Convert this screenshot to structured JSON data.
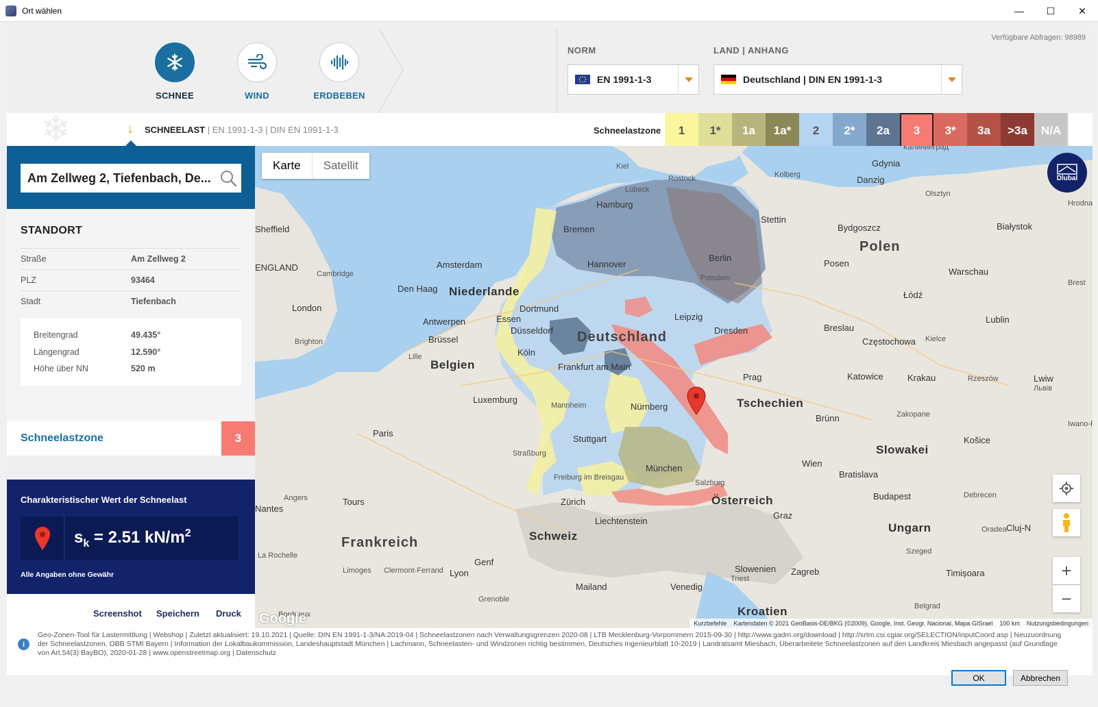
{
  "window": {
    "title": "Ort wählen",
    "minimize": "—",
    "maximize": "☐",
    "close": "✕"
  },
  "header": {
    "tabs": [
      {
        "label": "SCHNEE",
        "icon": "snowflake-icon",
        "active": true
      },
      {
        "label": "WIND",
        "icon": "wind-icon",
        "active": false
      },
      {
        "label": "ERDBEBEN",
        "icon": "earthquake-icon",
        "active": false
      }
    ],
    "available_queries": "Verfügbare Abfragen: 98989",
    "norm_label": "NORM",
    "norm_value": "EN 1991-1-3",
    "country_label": "LAND | ANHANG",
    "country_value": "Deutschland | DIN EN 1991-1-3"
  },
  "subbar": {
    "title": "SCHNEELAST",
    "sep1": " | ",
    "norm1": "EN 1991-1-3",
    "sep2": " | ",
    "norm2": "DIN EN 1991-1-3",
    "zones_label": "Schneelastzone",
    "zones": [
      {
        "label": "1",
        "color": "#fbf59e",
        "text": "#555"
      },
      {
        "label": "1*",
        "color": "#e0df9a",
        "text": "#555"
      },
      {
        "label": "1a",
        "color": "#b7b47c",
        "text": "#fff"
      },
      {
        "label": "1a*",
        "color": "#8b8858",
        "text": "#fff"
      },
      {
        "label": "2",
        "color": "#b5d4f2",
        "text": "#555"
      },
      {
        "label": "2*",
        "color": "#85a9cc",
        "text": "#fff"
      },
      {
        "label": "2a",
        "color": "#5d7590",
        "text": "#fff"
      },
      {
        "label": "3",
        "color": "#f77b72",
        "text": "#fff",
        "selected": true
      },
      {
        "label": "3*",
        "color": "#d96a5f",
        "text": "#fff"
      },
      {
        "label": "3a",
        "color": "#b55247",
        "text": "#fff"
      },
      {
        "label": ">3a",
        "color": "#8c3a33",
        "text": "#fff"
      },
      {
        "label": "N/A",
        "color": "#c6c6c6",
        "text": "#fff"
      }
    ]
  },
  "search": {
    "value": "Am Zellweg 2, Tiefenbach, De..."
  },
  "standort": {
    "title": "STANDORT",
    "rows": [
      {
        "key": "Straße",
        "value": "Am Zellweg 2"
      },
      {
        "key": "PLZ",
        "value": "93464"
      },
      {
        "key": "Stadt",
        "value": "Tiefenbach"
      }
    ],
    "geo": [
      {
        "key": "Breitengrad",
        "value": "49.435°"
      },
      {
        "key": "Längengrad",
        "value": "12.590°"
      },
      {
        "key": "Höhe über NN",
        "value": "520 m"
      }
    ]
  },
  "zone_result": {
    "label": "Schneelastzone",
    "value": "3"
  },
  "result": {
    "title": "Charakteristischer Wert der Schneelast",
    "symbol": "s",
    "subscript": "k",
    "value": " = 2.51 kN/m",
    "superscript": "2",
    "note": "Alle Angaben ohne Gewähr"
  },
  "actions": [
    "Screenshot",
    "Speichern",
    "Druck"
  ],
  "map": {
    "toggle": [
      "Karte",
      "Satellit"
    ],
    "brand": "Dlubal",
    "zoom_in": "+",
    "zoom_out": "−",
    "google": "Google",
    "footer": [
      "Kurzbefehle",
      "Kartendaten © 2021 GeoBasis-DE/BKG (©2009), Google, Inst. Geogr. Nacional, Mapa GISrael",
      "100 km",
      "Nutzungsbedingungen"
    ],
    "labels": [
      {
        "t": "Deutschland",
        "cls": "big"
      },
      {
        "t": "Polen",
        "cls": "big"
      },
      {
        "t": "Tschechien",
        "cls": "country"
      },
      {
        "t": "Österreich",
        "cls": "country"
      },
      {
        "t": "Frankreich",
        "cls": "big"
      },
      {
        "t": "Schweiz",
        "cls": "country"
      },
      {
        "t": "Slowakei",
        "cls": "country"
      },
      {
        "t": "Ungarn",
        "cls": "country"
      },
      {
        "t": "Kroatien",
        "cls": "country"
      },
      {
        "t": "Belgien",
        "cls": "country"
      },
      {
        "t": "Niederlande",
        "cls": "country"
      },
      {
        "t": "Slowenien",
        "cls": ""
      },
      {
        "t": "Liechtenstein",
        "cls": ""
      },
      {
        "t": "Luxemburg",
        "cls": ""
      },
      {
        "t": "Hamburg",
        "cls": ""
      },
      {
        "t": "Bremen",
        "cls": ""
      },
      {
        "t": "Hannover",
        "cls": ""
      },
      {
        "t": "Berlin",
        "cls": ""
      },
      {
        "t": "Potsdam",
        "cls": "small"
      },
      {
        "t": "Leipzig",
        "cls": ""
      },
      {
        "t": "Dresden",
        "cls": ""
      },
      {
        "t": "Dortmund",
        "cls": ""
      },
      {
        "t": "Essen",
        "cls": ""
      },
      {
        "t": "Düsseldorf",
        "cls": ""
      },
      {
        "t": "Köln",
        "cls": ""
      },
      {
        "t": "Frankfurt am Main",
        "cls": ""
      },
      {
        "t": "Mannheim",
        "cls": "small"
      },
      {
        "t": "Nürnberg",
        "cls": ""
      },
      {
        "t": "Stuttgart",
        "cls": ""
      },
      {
        "t": "München",
        "cls": ""
      },
      {
        "t": "Freiburg im Breisgau",
        "cls": "small"
      },
      {
        "t": "Amsterdam",
        "cls": ""
      },
      {
        "t": "Den Haag",
        "cls": ""
      },
      {
        "t": "Antwerpen",
        "cls": ""
      },
      {
        "t": "Brüssel",
        "cls": ""
      },
      {
        "t": "London",
        "cls": ""
      },
      {
        "t": "Paris",
        "cls": ""
      },
      {
        "t": "Prag",
        "cls": ""
      },
      {
        "t": "Wien",
        "cls": ""
      },
      {
        "t": "Bratislava",
        "cls": ""
      },
      {
        "t": "Budapest",
        "cls": ""
      },
      {
        "t": "Zürich",
        "cls": ""
      },
      {
        "t": "Salzburg",
        "cls": "small"
      },
      {
        "t": "Graz",
        "cls": ""
      },
      {
        "t": "Zagreb",
        "cls": ""
      },
      {
        "t": "Venedig",
        "cls": ""
      },
      {
        "t": "Mailand",
        "cls": ""
      },
      {
        "t": "Genf",
        "cls": ""
      },
      {
        "t": "Lyon",
        "cls": ""
      },
      {
        "t": "Straßburg",
        "cls": "small"
      },
      {
        "t": "Stettin",
        "cls": ""
      },
      {
        "t": "Danzig",
        "cls": ""
      },
      {
        "t": "Gdynia",
        "cls": ""
      },
      {
        "t": "Posen",
        "cls": ""
      },
      {
        "t": "Breslau",
        "cls": ""
      },
      {
        "t": "Warschau",
        "cls": ""
      },
      {
        "t": "Łódź",
        "cls": ""
      },
      {
        "t": "Lublin",
        "cls": ""
      },
      {
        "t": "Krakau",
        "cls": ""
      },
      {
        "t": "Katowice",
        "cls": ""
      },
      {
        "t": "Brünn",
        "cls": ""
      },
      {
        "t": "Bydgoszcz",
        "cls": ""
      },
      {
        "t": "Białystok",
        "cls": ""
      },
      {
        "t": "Rostock",
        "cls": "small"
      },
      {
        "t": "Lübeck",
        "cls": "small"
      },
      {
        "t": "Kiel",
        "cls": "small"
      },
      {
        "t": "Kolberg",
        "cls": "small"
      },
      {
        "t": "Olsztyn",
        "cls": "small"
      },
      {
        "t": "Częstochowa",
        "cls": ""
      },
      {
        "t": "Košice",
        "cls": ""
      },
      {
        "t": "Debrecen",
        "cls": "small"
      },
      {
        "t": "Timișoara",
        "cls": ""
      },
      {
        "t": "Cluj-N",
        "cls": ""
      },
      {
        "t": "Lwiw",
        "cls": ""
      },
      {
        "t": "Львів",
        "cls": "small"
      },
      {
        "t": "Rzeszów",
        "cls": "small"
      },
      {
        "t": "Tours",
        "cls": ""
      },
      {
        "t": "Angers",
        "cls": "small"
      },
      {
        "t": "Nantes",
        "cls": ""
      },
      {
        "t": "Limoges",
        "cls": "small"
      },
      {
        "t": "Clermont-Ferrand",
        "cls": "small"
      },
      {
        "t": "La Rochelle",
        "cls": "small"
      },
      {
        "t": "Cambridge",
        "cls": "small"
      },
      {
        "t": "Brighton",
        "cls": "small"
      },
      {
        "t": "Sheffield",
        "cls": ""
      },
      {
        "t": "Lille",
        "cls": "small"
      },
      {
        "t": "ENGLAND",
        "cls": ""
      },
      {
        "t": "Triest",
        "cls": "small"
      },
      {
        "t": "Grenoble",
        "cls": "small"
      },
      {
        "t": "Szeged",
        "cls": "small"
      },
      {
        "t": "Oradea",
        "cls": "small"
      },
      {
        "t": "Kielce",
        "cls": "small"
      },
      {
        "t": "Zakopane",
        "cls": "small"
      },
      {
        "t": "Belgrad",
        "cls": "small"
      },
      {
        "t": "Bordeaux",
        "cls": "small"
      },
      {
        "t": "Hrodna",
        "cls": "small"
      },
      {
        "t": "Brest",
        "cls": "small"
      },
      {
        "t": "Iwano-Fr",
        "cls": "small"
      },
      {
        "t": "Калининград",
        "cls": "small"
      }
    ]
  },
  "info_text": "Geo-Zonen-Tool für Lastermittlung | Webshop | Zuletzt aktualisiert: 19.10.2021 | Quelle: DIN EN 1991-1-3/NA:2019-04 | Schneelastzonen nach Verwaltungsgrenzen 2020-08 | LTB Mecklenburg-Vorpommern 2015-09-30 | http://www.gadm.org/download | http://srtm.csi.cgiar.org/SELECTION/inputCoord.asp | Neuzuordnung der Schneelastzonen, OBB STMI Bayern | Information der Lokalbaukommission, Landeshauptstadt München | Lachmann, Schneelasten- und Windzonen richtig bestimmen, Deutsches Ingenieurblatt 10-2019 | Landratsamt Miesbach, Überarbeitete Schneelastzonen auf den Landkreis Miesbach angepasst (auf Grundlage von Art.54(3) BayBO), 2020-01-28 | www.openstreetmap.org | Datenschutz",
  "dialog": {
    "ok": "OK",
    "cancel": "Abbrechen"
  }
}
